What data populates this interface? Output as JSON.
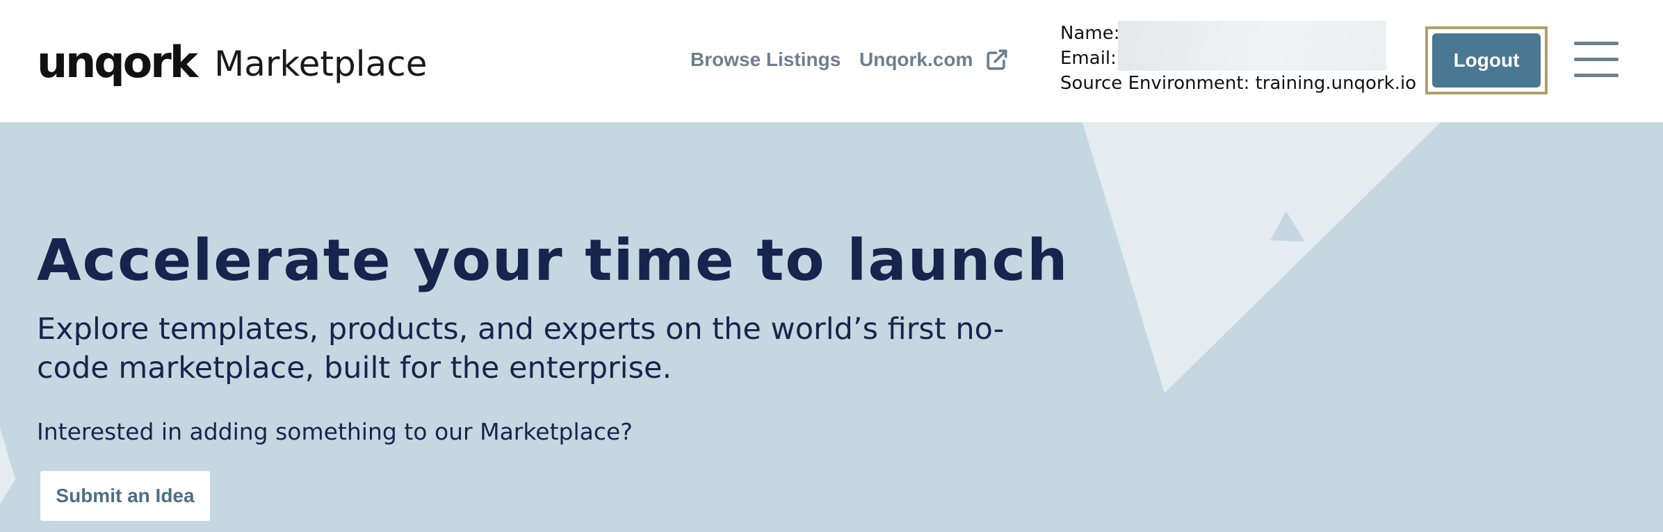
{
  "brand": {
    "wordmark": "unqork",
    "subtitle": "Marketplace"
  },
  "nav": {
    "browse_label": "Browse Listings",
    "unqork_label": "Unqork.com",
    "unqork_icon": "external-link-icon"
  },
  "user": {
    "name_label": "Name:",
    "email_label": "Email:",
    "source_env_text": "Source Environment: training.unqork.io"
  },
  "header": {
    "logout_label": "Logout",
    "menu_icon": "hamburger-menu-icon"
  },
  "hero": {
    "title": "Accelerate your time to launch",
    "subtitle": "Explore templates, products, and experts on the world’s first no-code marketplace, built for the enterprise.",
    "question": "Interested in adding something to our Marketplace?",
    "submit_label": "Submit an Idea"
  },
  "colors": {
    "hero_bg": "#c5d8e1",
    "hero_text": "#15254d",
    "logout_bg": "#4a7791",
    "focus_outline": "#b39e6a",
    "nav_text": "#6d7e8f"
  }
}
